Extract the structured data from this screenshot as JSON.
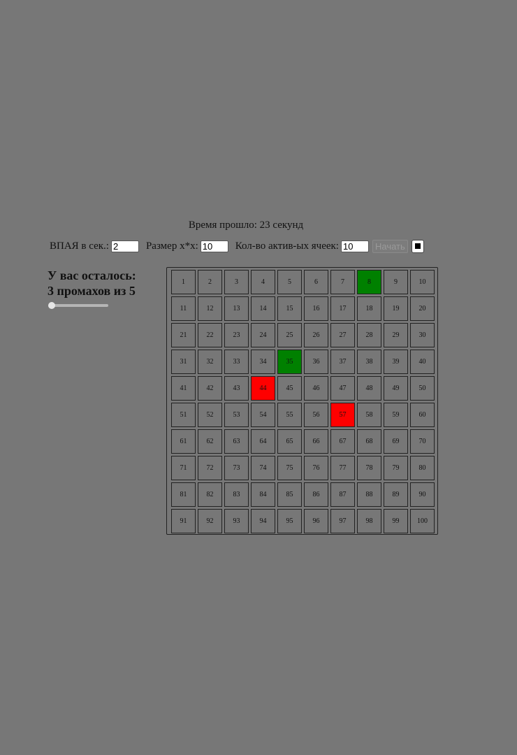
{
  "timer": {
    "text": "Время прошло: 23 секунд"
  },
  "controls": {
    "interval_label": "ВПАЯ в сек.:",
    "interval_value": "2",
    "size_label": "Размер x*x:",
    "size_value": "10",
    "active_label": "Кол-во актив-ых ячеек:",
    "active_value": "10",
    "start_label": "Начать",
    "stop_icon": "stop-square-icon"
  },
  "status": {
    "line1": "У вас осталось:",
    "line2": "3 промахов из 5"
  },
  "slider": {
    "value_fraction": 0.0
  },
  "board": {
    "size": 10,
    "cells": [
      "1",
      "2",
      "3",
      "4",
      "5",
      "6",
      "7",
      "8",
      "9",
      "10",
      "11",
      "12",
      "13",
      "14",
      "15",
      "16",
      "17",
      "18",
      "19",
      "20",
      "21",
      "22",
      "23",
      "24",
      "25",
      "26",
      "27",
      "28",
      "29",
      "30",
      "31",
      "32",
      "33",
      "34",
      "35",
      "36",
      "37",
      "38",
      "39",
      "40",
      "41",
      "42",
      "43",
      "44",
      "45",
      "46",
      "47",
      "48",
      "49",
      "50",
      "51",
      "52",
      "53",
      "54",
      "55",
      "56",
      "57",
      "58",
      "59",
      "60",
      "61",
      "62",
      "63",
      "64",
      "65",
      "66",
      "67",
      "68",
      "69",
      "70",
      "71",
      "72",
      "73",
      "74",
      "75",
      "76",
      "77",
      "78",
      "79",
      "80",
      "81",
      "82",
      "83",
      "84",
      "85",
      "86",
      "87",
      "88",
      "89",
      "90",
      "91",
      "92",
      "93",
      "94",
      "95",
      "96",
      "97",
      "98",
      "99",
      "100"
    ],
    "hits": [
      "8",
      "35"
    ],
    "misses": [
      "44",
      "57"
    ],
    "colors": {
      "cell": "#777777",
      "hit": "#008000",
      "miss": "#ff0000",
      "border": "#222222"
    }
  }
}
